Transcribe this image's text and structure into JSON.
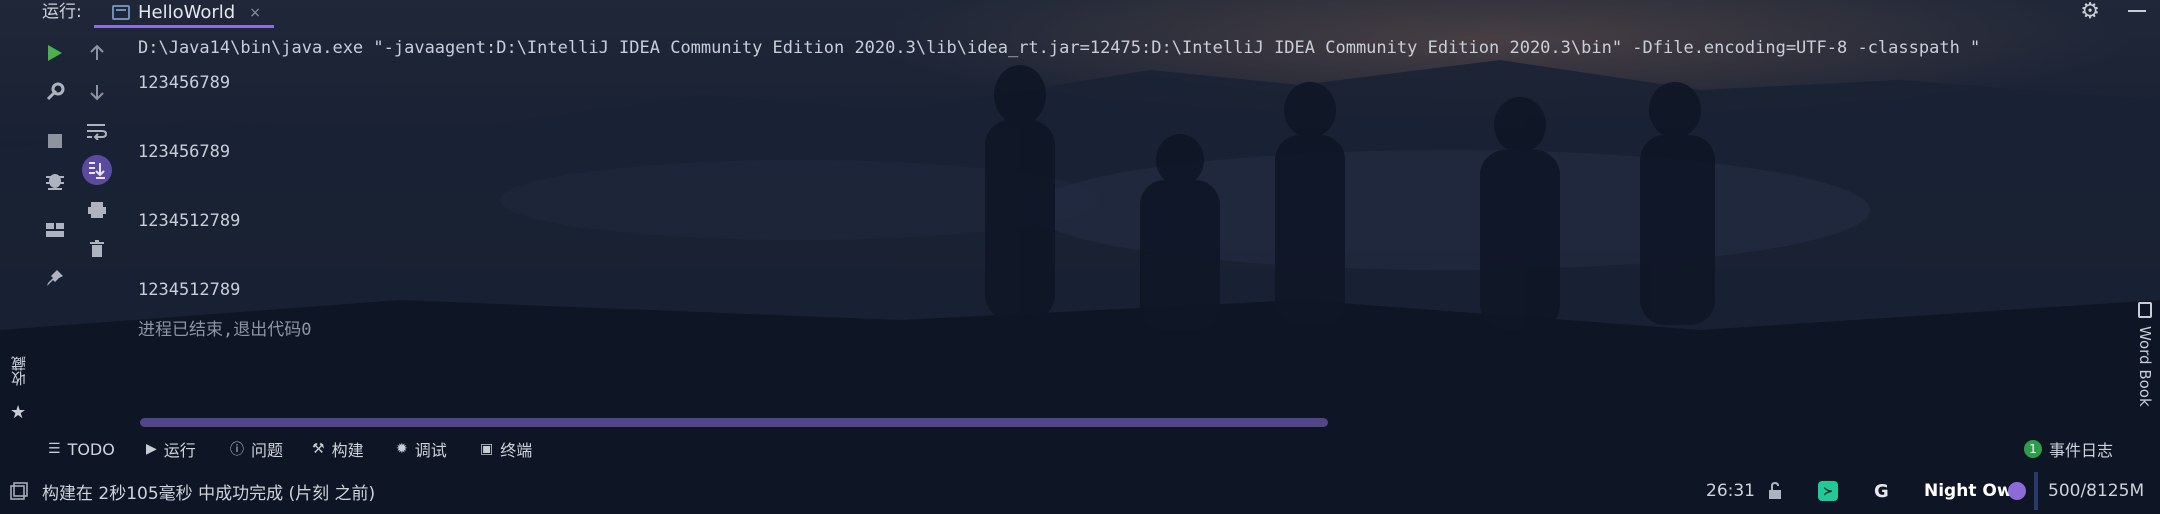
{
  "header": {
    "run_label": "运行:",
    "tab_title": "HelloWorld",
    "tab_close": "×"
  },
  "console": {
    "command": "D:\\Java14\\bin\\java.exe \"-javaagent:D:\\IntelliJ IDEA Community Edition 2020.3\\lib\\idea_rt.jar=12475:D:\\IntelliJ IDEA Community Edition 2020.3\\bin\" -Dfile.encoding=UTF-8 -classpath \"",
    "lines": [
      "123456789",
      "123456789",
      "1234512789",
      "1234512789"
    ],
    "exit_message": "进程已结束,退出代码0"
  },
  "bottom_tabs": [
    {
      "label": "TODO",
      "icon": "list-icon"
    },
    {
      "label": "运行",
      "icon": "play-icon"
    },
    {
      "label": "问题",
      "icon": "info-icon"
    },
    {
      "label": "构建",
      "icon": "hammer-icon"
    },
    {
      "label": "调试",
      "icon": "bug-icon"
    },
    {
      "label": "终端",
      "icon": "terminal-icon"
    }
  ],
  "event_log": {
    "badge": "1",
    "label": "事件日志"
  },
  "side": {
    "favorites": "收藏",
    "word_book": "Word Book"
  },
  "status": {
    "message": "构建在 2秒105毫秒 中成功完成 (片刻 之前)",
    "position": "26:31",
    "theme": "Night Owl",
    "memory": "500/8125M"
  },
  "colors": {
    "accent": "#8b6fd6",
    "run_green": "#4caf50",
    "theme_dot": "#8c6ad8",
    "event_badge": "#2e9d4a"
  }
}
